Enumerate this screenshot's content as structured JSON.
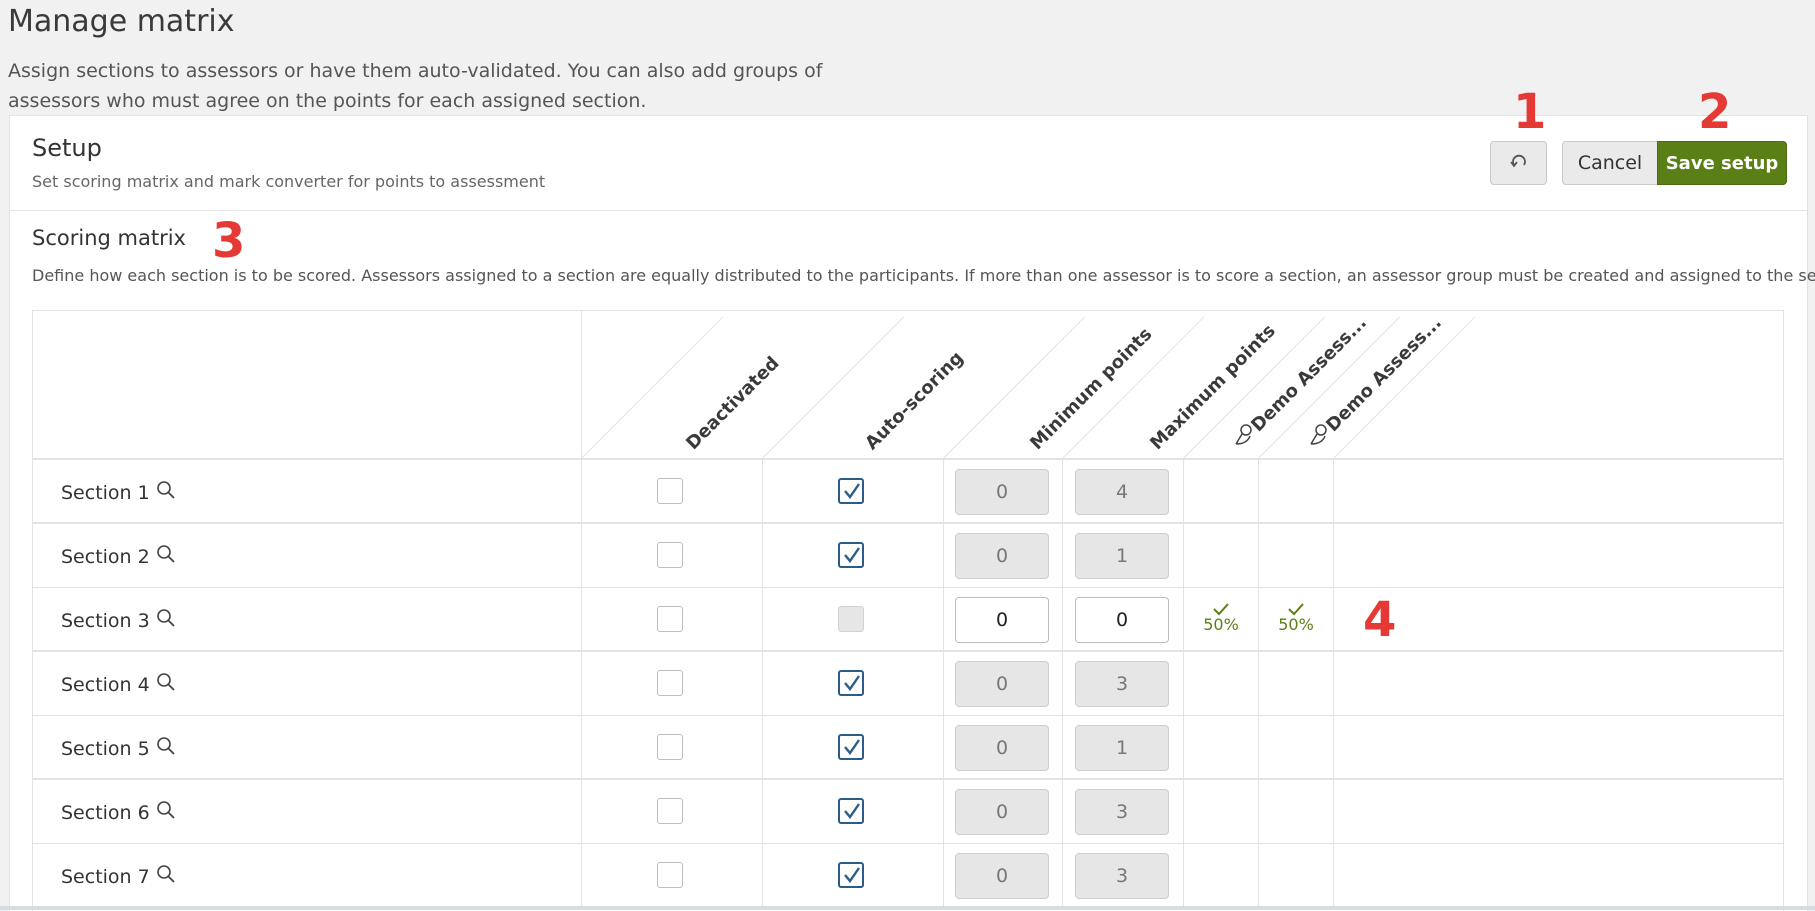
{
  "page": {
    "title": "Manage matrix",
    "description": "Assign sections to assessors or have them auto-validated. You can also add groups of assessors who must agree on the points for each assigned section."
  },
  "setup": {
    "title": "Setup",
    "subtitle": "Set scoring matrix and mark converter for points to assessment",
    "reset_icon": "reset-icon",
    "cancel_label": "Cancel",
    "save_label": "Save setup"
  },
  "markers": {
    "m1": "1",
    "m2": "2",
    "m3": "3",
    "m4": "4"
  },
  "matrix": {
    "title": "Scoring matrix",
    "description": "Define how each section is to be scored. Assessors assigned to a section are equally distributed to the participants. If more than one assessor is to score a section, an assessor group must be created and assigned to the section.",
    "columns": {
      "deactivated": "Deactivated",
      "auto_scoring": "Auto-scoring",
      "min_points": "Minimum points",
      "max_points": "Maximum points",
      "assessor1": "Demo Assess...",
      "assessor2": "Demo Assess..."
    },
    "rows": [
      {
        "label": "Section 1",
        "deactivated": false,
        "auto": true,
        "min": "0",
        "max": "4"
      },
      {
        "label": "Section 2",
        "deactivated": false,
        "auto": true,
        "min": "0",
        "max": "1"
      },
      {
        "label": "Section 3",
        "deactivated": false,
        "auto": false,
        "min": "0",
        "max": "0",
        "a1": "50%",
        "a2": "50%"
      },
      {
        "label": "Section 4",
        "deactivated": false,
        "auto": true,
        "min": "0",
        "max": "3"
      },
      {
        "label": "Section 5",
        "deactivated": false,
        "auto": true,
        "min": "0",
        "max": "1"
      },
      {
        "label": "Section 6",
        "deactivated": false,
        "auto": true,
        "min": "0",
        "max": "3"
      },
      {
        "label": "Section 7",
        "deactivated": false,
        "auto": true,
        "min": "0",
        "max": "3"
      }
    ]
  },
  "colors": {
    "accent_green": "#5b7f17",
    "checkbox_blue": "#2b5c8a",
    "marker_red": "#e53935"
  }
}
